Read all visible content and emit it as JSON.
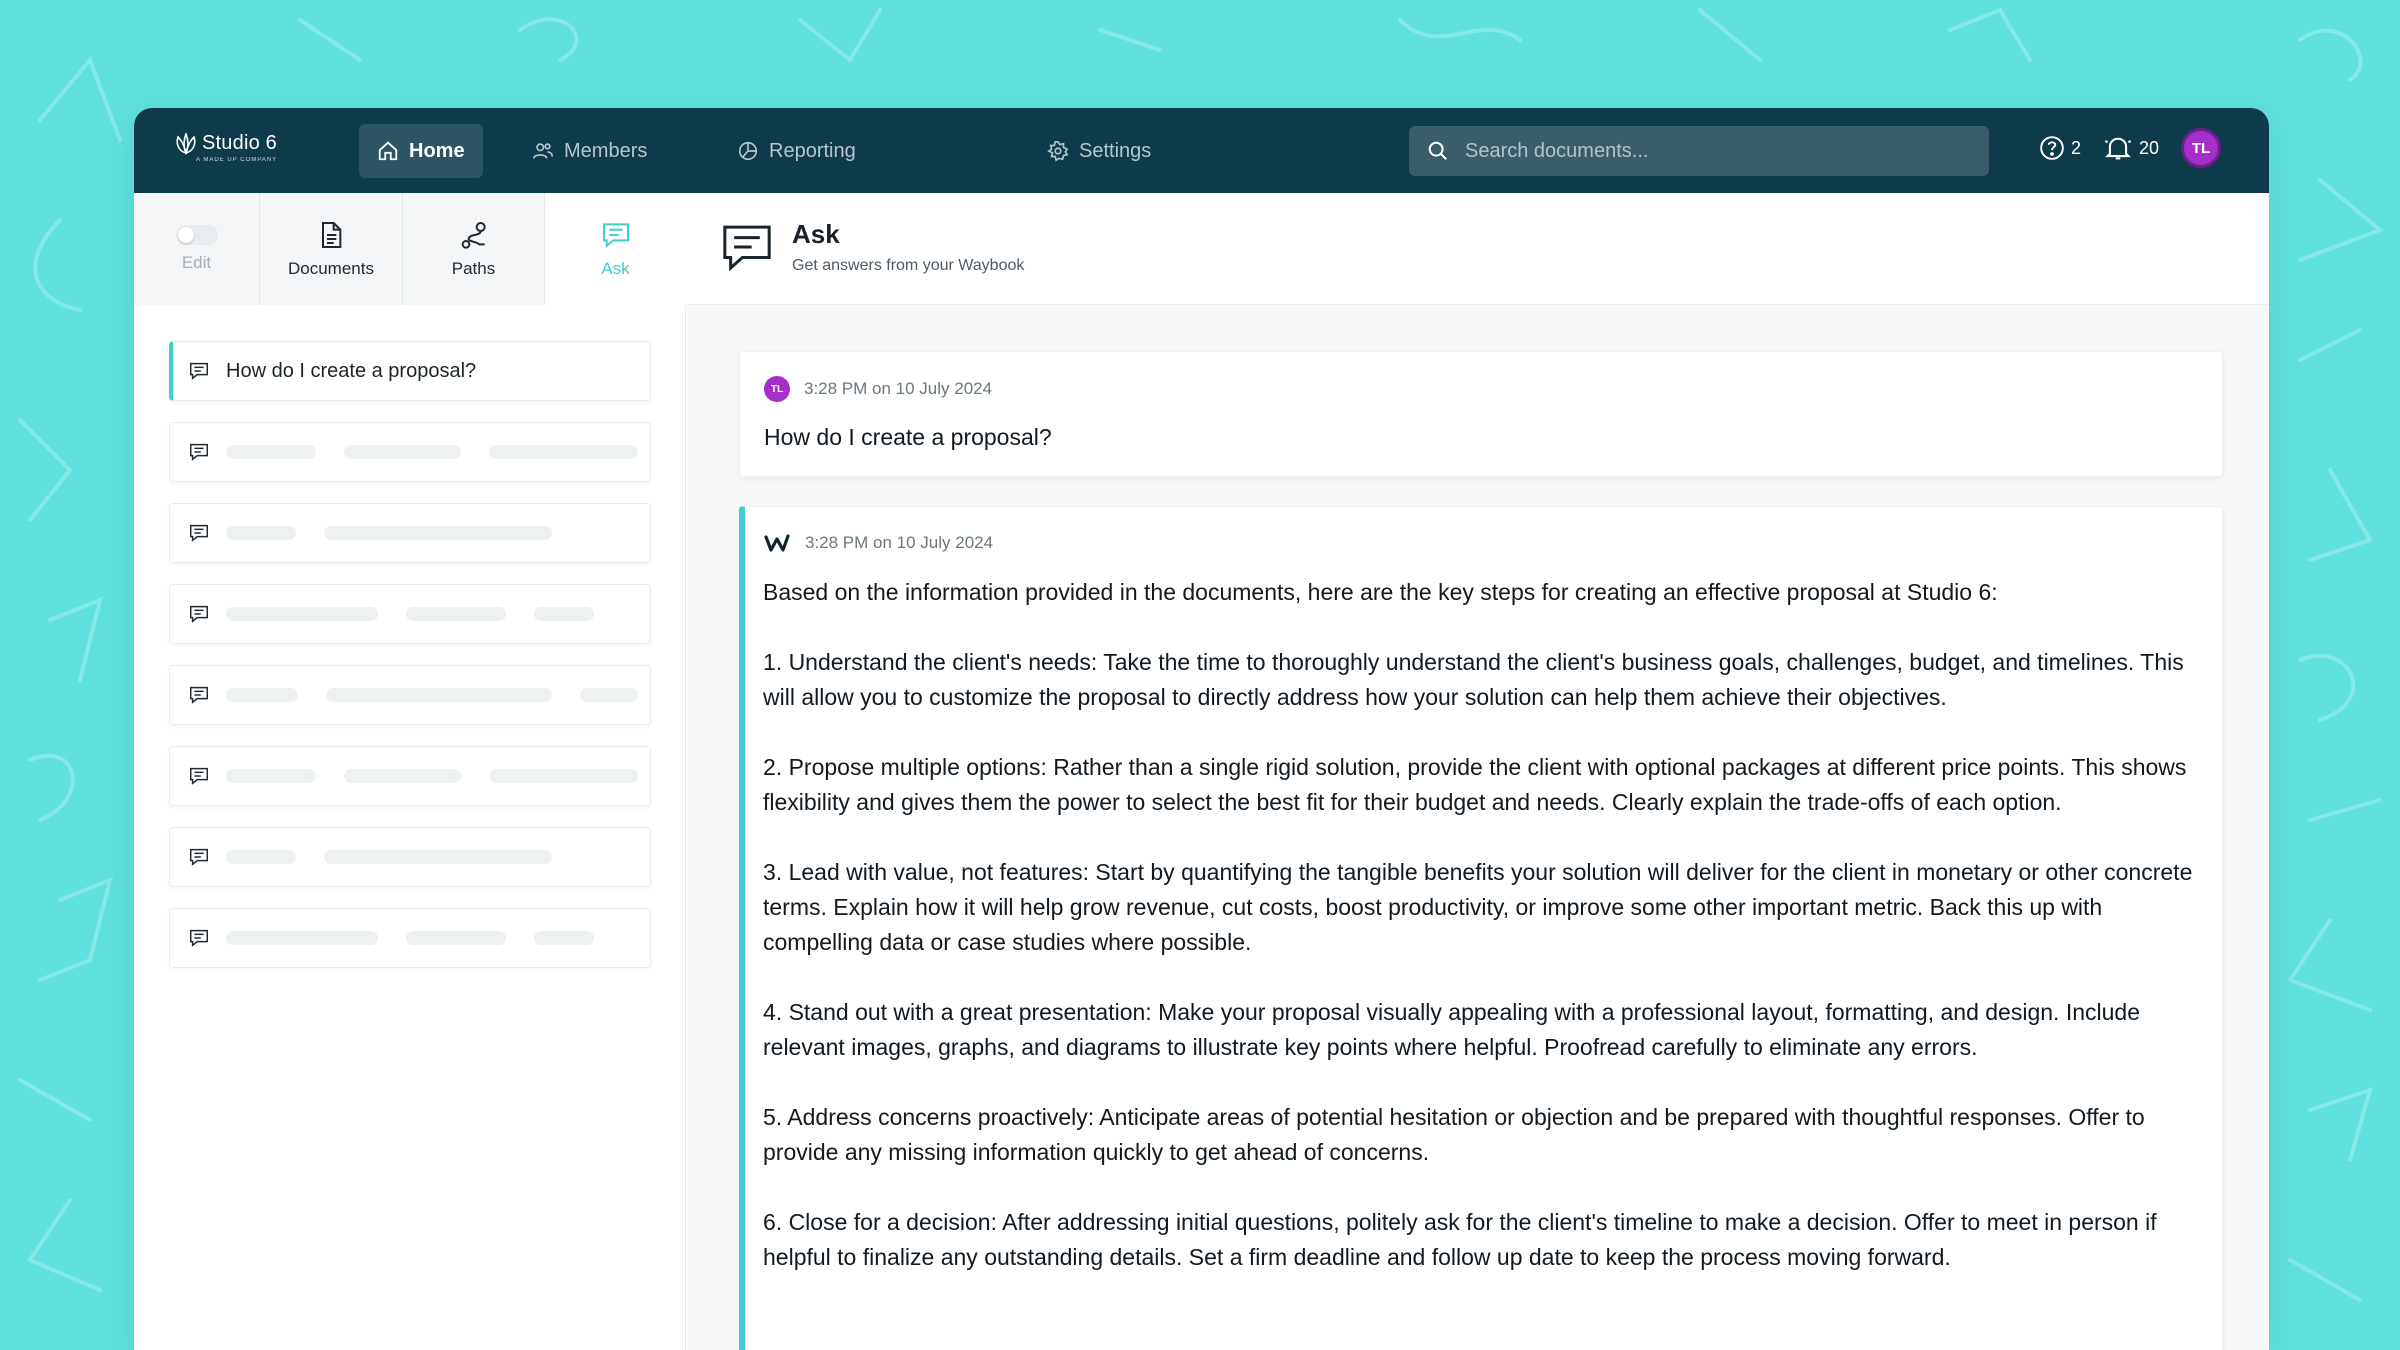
{
  "brand": {
    "name": "Studio 6",
    "tagline": "A MADE UP COMPANY"
  },
  "nav": {
    "items": [
      {
        "label": "Home",
        "icon": "home-icon",
        "active": true
      },
      {
        "label": "Members",
        "icon": "members-icon",
        "active": false
      },
      {
        "label": "Reporting",
        "icon": "reporting-icon",
        "active": false
      },
      {
        "label": "Settings",
        "icon": "gear-icon",
        "active": false
      }
    ]
  },
  "search": {
    "placeholder": "Search documents..."
  },
  "header_right": {
    "help_count": "2",
    "notification_count": "20",
    "user_initials": "TL"
  },
  "sidebar": {
    "tabs": {
      "edit": "Edit",
      "documents": "Documents",
      "paths": "Paths",
      "ask": "Ask"
    },
    "conversations": [
      {
        "label": "How do I create a proposal?",
        "active": true
      }
    ]
  },
  "main": {
    "title": "Ask",
    "subtitle": "Get answers from your Waybook",
    "user_message": {
      "initials": "TL",
      "timestamp": "3:28 PM on 10 July 2024",
      "text": "How do I create a proposal?"
    },
    "bot_message": {
      "timestamp": "3:28 PM on 10 July 2024",
      "paragraphs": [
        "Based on the information provided in the documents, here are the key steps for creating an effective proposal at Studio 6:",
        "1. Understand the client's needs: Take the time to thoroughly understand the client's business goals, challenges, budget, and timelines. This will allow you to customize the proposal to directly address how your solution can help them achieve their objectives.",
        "2. Propose multiple options: Rather than a single rigid solution, provide the client with optional packages at different price points. This shows flexibility and gives them the power to select the best fit for their budget and needs. Clearly explain the trade-offs of each option.",
        "3. Lead with value, not features: Start by quantifying the tangible benefits your solution will deliver for the client in monetary or other concrete terms. Explain how it will help grow revenue, cut costs, boost productivity, or improve some other important metric. Back this up with compelling data or case studies where possible.",
        "4. Stand out with a great presentation: Make your proposal visually appealing with a professional layout, formatting, and design. Include relevant images, graphs, and diagrams to illustrate key points where helpful. Proofread carefully to eliminate any errors.",
        "5. Address concerns proactively: Anticipate areas of potential hesitation or objection and be prepared with thoughtful responses. Offer to provide any missing information quickly to get ahead of concerns.",
        "6. Close for a decision: After addressing initial questions, politely ask for the client's timeline to make a decision. Offer to meet in person if helpful to finalize any outstanding details. Set a firm deadline and follow up date to keep the process moving forward."
      ]
    }
  },
  "colors": {
    "background": "#5fe0dc",
    "topbar": "#0d3b4a",
    "accent": "#3fcfcb",
    "avatar": "#a42fc9"
  }
}
